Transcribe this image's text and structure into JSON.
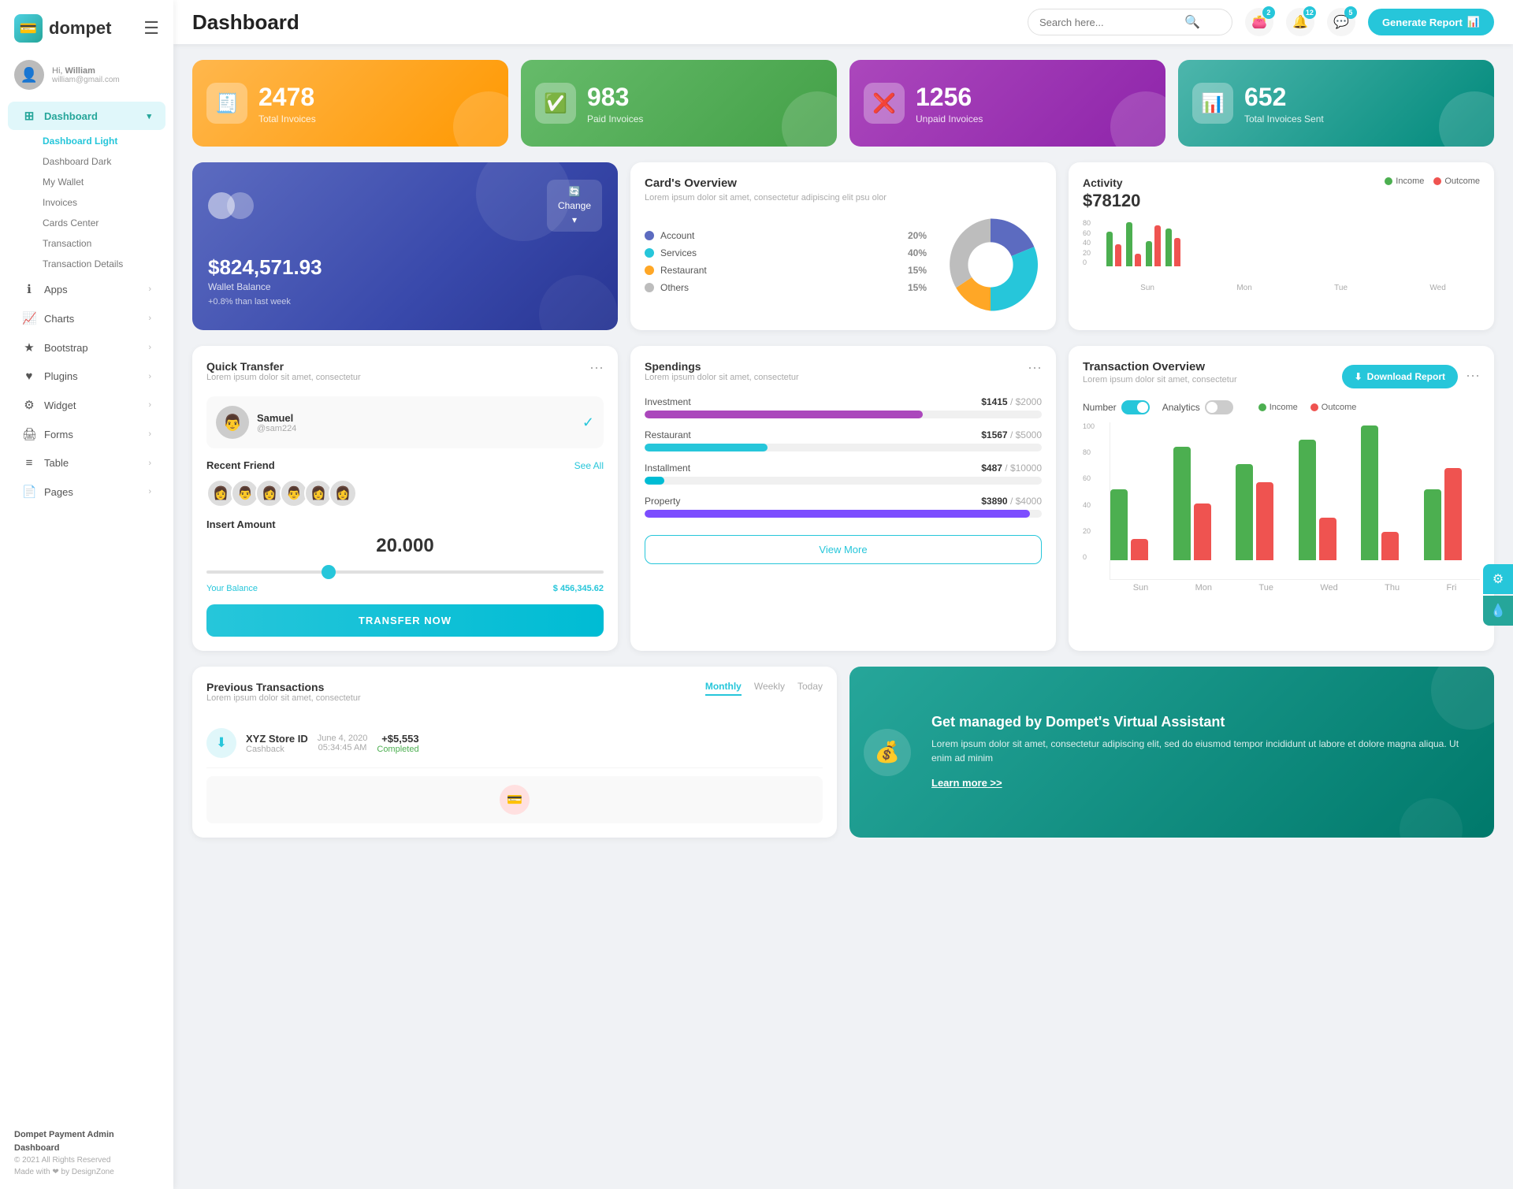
{
  "app": {
    "logo_text": "dompet",
    "logo_icon": "💳"
  },
  "topbar": {
    "title": "Dashboard",
    "search_placeholder": "Search here...",
    "generate_report_label": "Generate Report",
    "notification_badges": {
      "wallet": "2",
      "bell": "12",
      "chat": "5"
    }
  },
  "sidebar": {
    "user": {
      "greeting": "Hi,",
      "name": "William",
      "email": "william@gmail.com"
    },
    "menu_items": [
      {
        "icon": "⊞",
        "label": "Dashboard",
        "active": true,
        "has_arrow": true
      },
      {
        "icon": "ℹ",
        "label": "Apps",
        "active": false,
        "has_arrow": true
      },
      {
        "icon": "📈",
        "label": "Charts",
        "active": false,
        "has_arrow": true
      },
      {
        "icon": "★",
        "label": "Bootstrap",
        "active": false,
        "has_arrow": true
      },
      {
        "icon": "♥",
        "label": "Plugins",
        "active": false,
        "has_arrow": true
      },
      {
        "icon": "⚙",
        "label": "Widget",
        "active": false,
        "has_arrow": true
      },
      {
        "icon": "🖨",
        "label": "Forms",
        "active": false,
        "has_arrow": true
      },
      {
        "icon": "≡",
        "label": "Table",
        "active": false,
        "has_arrow": true
      },
      {
        "icon": "📄",
        "label": "Pages",
        "active": false,
        "has_arrow": true
      }
    ],
    "submenu": [
      {
        "label": "Dashboard Light",
        "active": true
      },
      {
        "label": "Dashboard Dark",
        "active": false
      },
      {
        "label": "My Wallet",
        "active": false
      },
      {
        "label": "Invoices",
        "active": false
      },
      {
        "label": "Cards Center",
        "active": false
      },
      {
        "label": "Transaction",
        "active": false
      },
      {
        "label": "Transaction Details",
        "active": false
      }
    ],
    "footer": {
      "brand": "Dompet Payment Admin Dashboard",
      "copy": "© 2021 All Rights Reserved",
      "made_by": "Made with ❤ by DesignZone"
    }
  },
  "stat_cards": [
    {
      "number": "2478",
      "label": "Total Invoices",
      "icon": "🧾",
      "color": "orange"
    },
    {
      "number": "983",
      "label": "Paid Invoices",
      "icon": "✅",
      "color": "green"
    },
    {
      "number": "1256",
      "label": "Unpaid Invoices",
      "icon": "❌",
      "color": "purple"
    },
    {
      "number": "652",
      "label": "Total Invoices Sent",
      "icon": "📊",
      "color": "teal"
    }
  ],
  "wallet": {
    "balance": "$824,571.93",
    "label": "Wallet Balance",
    "change_pct": "+0.8% than last week",
    "change_btn": "Change"
  },
  "cards_overview": {
    "title": "Card's Overview",
    "subtitle": "Lorem ipsum dolor sit amet, consectetur adipiscing elit psu olor",
    "items": [
      {
        "label": "Account",
        "pct": "20%",
        "color": "#5c6bc0"
      },
      {
        "label": "Services",
        "pct": "40%",
        "color": "#26c6da"
      },
      {
        "label": "Restaurant",
        "pct": "15%",
        "color": "#ffa726"
      },
      {
        "label": "Others",
        "pct": "15%",
        "color": "#bdbdbd"
      }
    ]
  },
  "activity": {
    "title": "Activity",
    "amount": "$78120",
    "income_label": "Income",
    "outcome_label": "Outcome",
    "income_color": "#4caf50",
    "outcome_color": "#ef5350",
    "bars": [
      {
        "day": "Sun",
        "income": 55,
        "outcome": 35
      },
      {
        "day": "Mon",
        "income": 70,
        "outcome": 20
      },
      {
        "day": "Tue",
        "income": 40,
        "outcome": 65
      },
      {
        "day": "Wed",
        "income": 60,
        "outcome": 45
      }
    ]
  },
  "quick_transfer": {
    "title": "Quick Transfer",
    "subtitle": "Lorem ipsum dolor sit amet, consectetur",
    "user_name": "Samuel",
    "user_handle": "@sam224",
    "recent_friends_label": "Recent Friend",
    "see_all_label": "See All",
    "insert_amount_label": "Insert Amount",
    "amount": "20.000",
    "balance_label": "Your Balance",
    "balance_amount": "$ 456,345.62",
    "transfer_btn": "TRANSFER NOW"
  },
  "spendings": {
    "title": "Spendings",
    "subtitle": "Lorem ipsum dolor sit amet, consectetur",
    "items": [
      {
        "label": "Investment",
        "amount": "$1415",
        "max": "$2000",
        "pct": 70,
        "color": "#ab47bc"
      },
      {
        "label": "Restaurant",
        "amount": "$1567",
        "max": "$5000",
        "pct": 31,
        "color": "#26c6da"
      },
      {
        "label": "Installment",
        "amount": "$487",
        "max": "$10000",
        "pct": 5,
        "color": "#00bcd4"
      },
      {
        "label": "Property",
        "amount": "$3890",
        "max": "$4000",
        "pct": 97,
        "color": "#7c4dff"
      }
    ],
    "view_more_label": "View More"
  },
  "transaction_overview": {
    "title": "Transaction Overview",
    "subtitle": "Lorem ipsum dolor sit amet, consectetur",
    "download_btn": "Download Report",
    "toggle_number_label": "Number",
    "toggle_analytics_label": "Analytics",
    "income_label": "Income",
    "outcome_label": "Outcome",
    "income_color": "#4caf50",
    "outcome_color": "#ef5350",
    "bars": [
      {
        "day": "Sun",
        "income": 50,
        "outcome": 15
      },
      {
        "day": "Mon",
        "income": 80,
        "outcome": 40
      },
      {
        "day": "Tue",
        "income": 68,
        "outcome": 55
      },
      {
        "day": "Wed",
        "income": 85,
        "outcome": 30
      },
      {
        "day": "Thu",
        "income": 95,
        "outcome": 20
      },
      {
        "day": "Fri",
        "income": 50,
        "outcome": 65
      }
    ],
    "y_labels": [
      "0",
      "20",
      "40",
      "60",
      "80",
      "100"
    ]
  },
  "previous_transactions": {
    "title": "Previous Transactions",
    "subtitle": "Lorem ipsum dolor sit amet, consectetur",
    "tabs": [
      "Monthly",
      "Weekly",
      "Today"
    ],
    "active_tab": "Monthly",
    "items": [
      {
        "store": "XYZ Store ID",
        "type": "Cashback",
        "date": "June 4, 2020",
        "time": "05:34:45 AM",
        "amount": "+$5,553",
        "status": "Completed"
      }
    ]
  },
  "virtual_assistant": {
    "title": "Get managed by Dompet's Virtual Assistant",
    "description": "Lorem ipsum dolor sit amet, consectetur adipiscing elit, sed do eiusmod tempor incididunt ut labore et dolore magna aliqua. Ut enim ad minim",
    "link": "Learn more >>",
    "icon": "💰"
  },
  "right_float_buttons": [
    {
      "icon": "⚙",
      "label": "settings"
    },
    {
      "icon": "💧",
      "label": "theme"
    }
  ]
}
